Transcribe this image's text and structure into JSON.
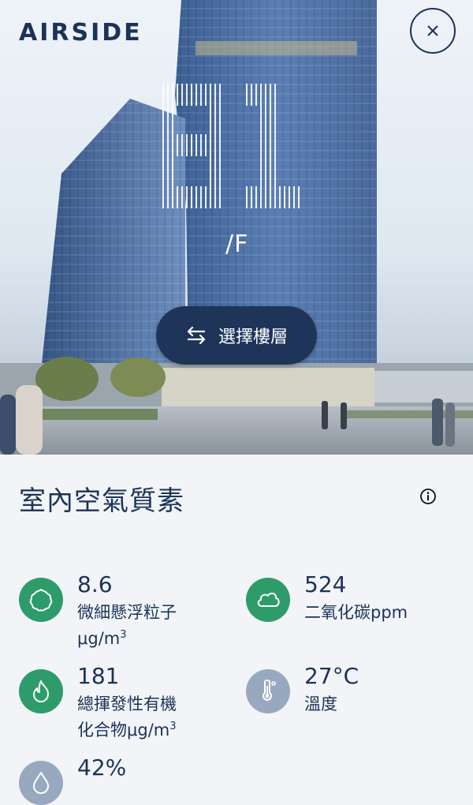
{
  "brand": {
    "logo": "AIRSIDE"
  },
  "hero": {
    "floor_unit": "/F",
    "select_floor_label": "選擇樓層"
  },
  "section": {
    "title": "室內空氣質素"
  },
  "metrics": [
    {
      "value": "8.6",
      "label_line1": "微細懸浮粒子",
      "label_line2": "μg/m",
      "label_sup": "3",
      "icon": "particle-icon",
      "color": "#2e9c6a"
    },
    {
      "value": "524",
      "label_line1": "二氧化碳ppm",
      "icon": "cloud-icon",
      "color": "#2e9c6a"
    },
    {
      "value": "181",
      "label_line1": "總揮發性有機",
      "label_line2": "化合物μg/m",
      "label_sup": "3",
      "icon": "flame-icon",
      "color": "#2e9c6a"
    },
    {
      "value": "27°C",
      "label_line1": "溫度",
      "icon": "thermometer-icon",
      "color": "#98a9bf"
    },
    {
      "value": "42%",
      "icon": "droplet-icon",
      "color": "#98a9bf"
    }
  ]
}
